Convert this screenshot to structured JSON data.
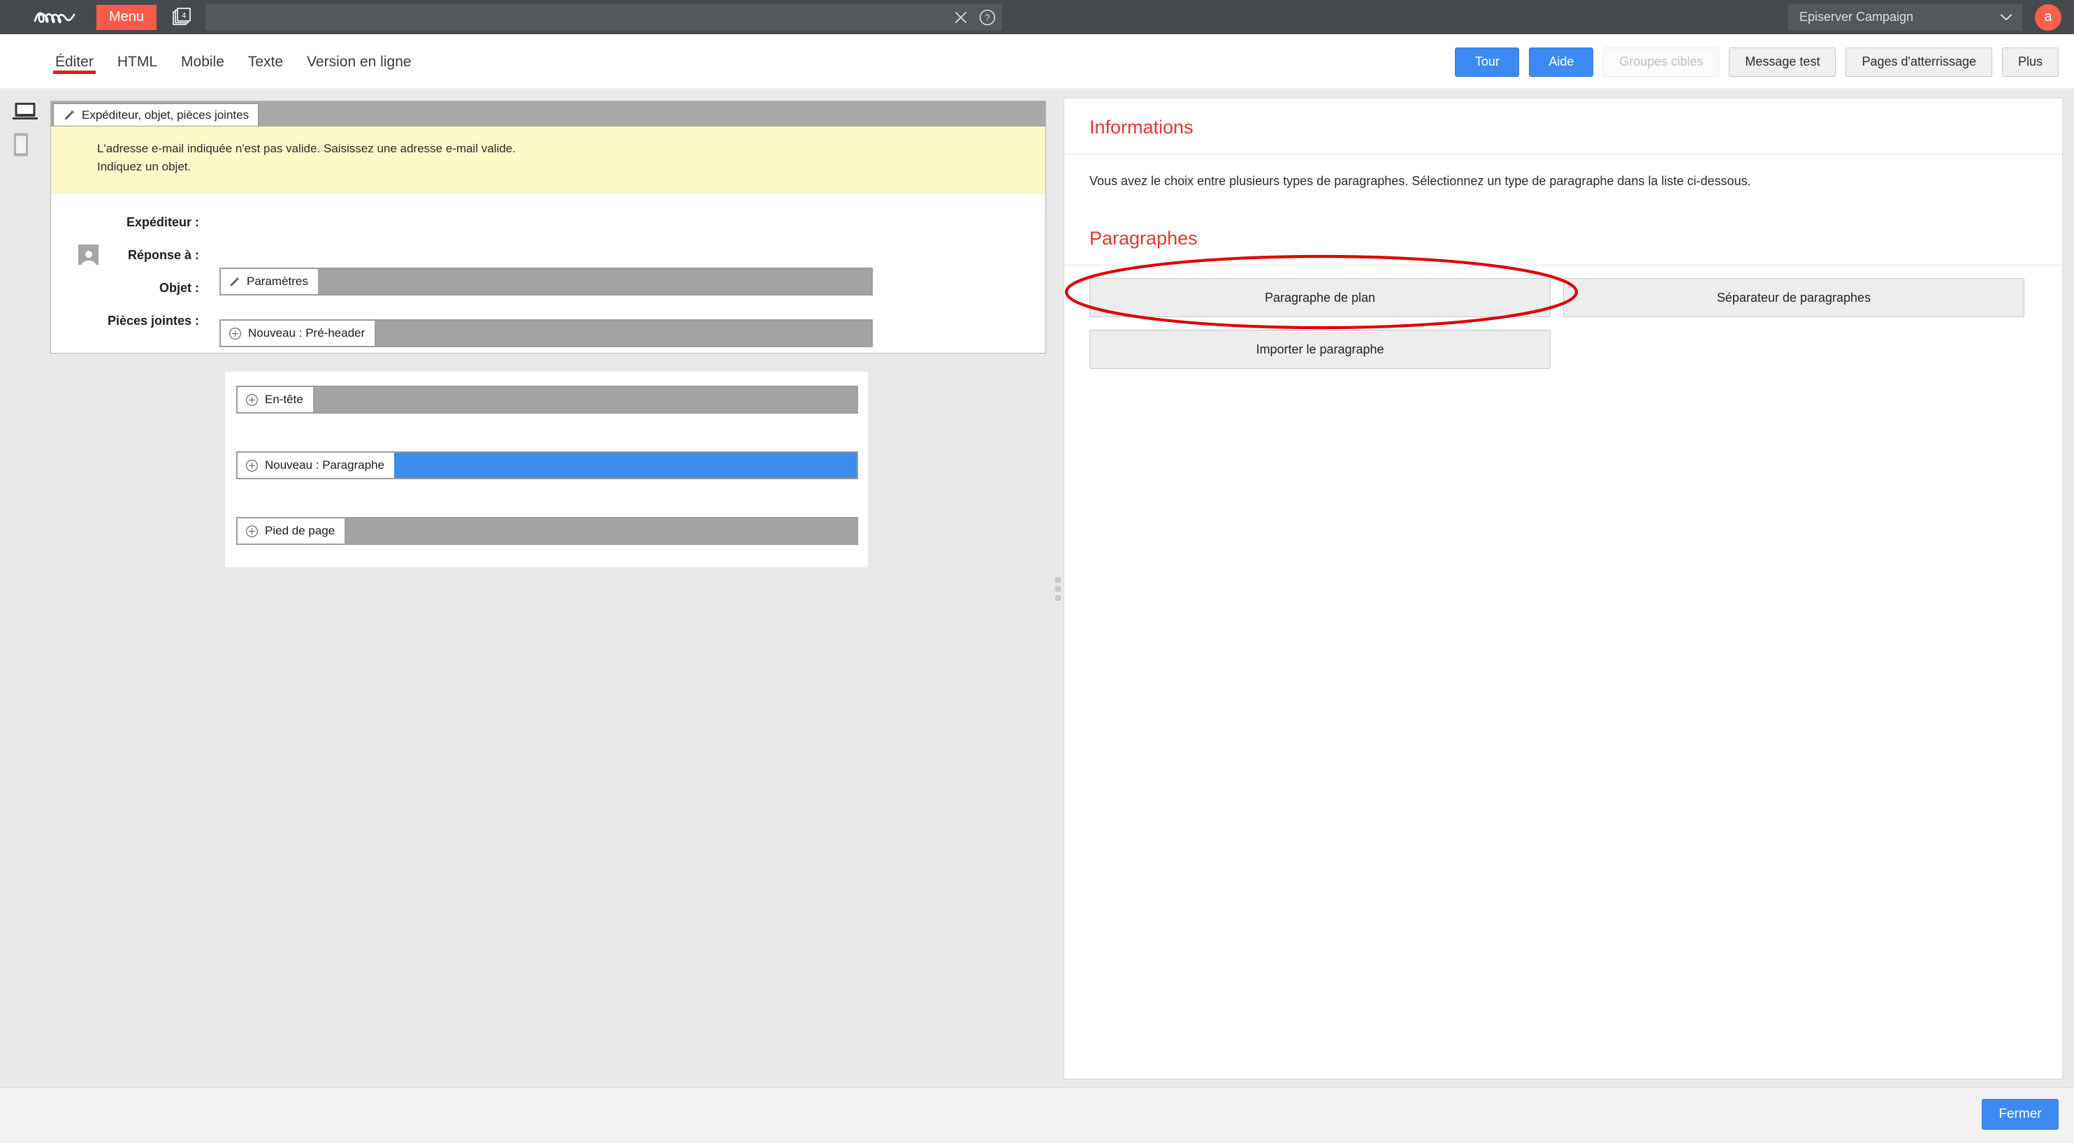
{
  "topbar": {
    "logo_alt": "Episerver",
    "menu_label": "Menu",
    "copies_badge": "4",
    "search_value": "",
    "search_placeholder": "",
    "app_selector_value": "Episerver Campaign",
    "avatar_initial": "a",
    "accent_orange": "#fc5a4b",
    "bar_bg": "#454a4d"
  },
  "toolbar": {
    "tabs": [
      {
        "label": "Éditer",
        "active": true
      },
      {
        "label": "HTML",
        "active": false
      },
      {
        "label": "Mobile",
        "active": false
      },
      {
        "label": "Texte",
        "active": false
      },
      {
        "label": "Version en ligne",
        "active": false
      }
    ],
    "buttons": [
      {
        "label": "Tour",
        "style": "primary"
      },
      {
        "label": "Aide",
        "style": "primary"
      },
      {
        "label": "Groupes cibles",
        "style": "disabled"
      },
      {
        "label": "Message test",
        "style": "normal"
      },
      {
        "label": "Pages d'atterrissage",
        "style": "normal"
      },
      {
        "label": "Plus",
        "style": "normal"
      }
    ],
    "active_tab_underline_color": "#e02020",
    "primary_color": "#3d8bf2"
  },
  "device_rail": {
    "desktop_label": "Aperçu bureau",
    "mobile_label": "Aperçu mobile"
  },
  "editor": {
    "sender_tab_label": "Expéditeur, objet, pièces jointes",
    "warning": {
      "line1": "L'adresse e-mail indiquée n'est pas valide. Saisissez une adresse e-mail valide.",
      "line2": "Indiquez un objet.",
      "bg": "#fcfac8"
    },
    "fields": [
      {
        "label": "Expéditeur :",
        "value": ""
      },
      {
        "label": "Réponse à :",
        "value": ""
      },
      {
        "label": "Objet :",
        "value": ""
      },
      {
        "label": "Pièces jointes :",
        "value": ""
      }
    ],
    "blocks": [
      {
        "id": "parametres",
        "label": "Paramètres",
        "icon": "brush-icon",
        "selected": false
      },
      {
        "id": "preheader",
        "label": "Nouveau : Pré-header",
        "icon": "plus-circle-icon",
        "selected": false
      },
      {
        "id": "entete",
        "label": "En-tête",
        "icon": "plus-circle-icon",
        "selected": false
      },
      {
        "id": "paragraphe",
        "label": "Nouveau : Paragraphe",
        "icon": "plus-circle-icon",
        "selected": true
      },
      {
        "id": "pied",
        "label": "Pied de page",
        "icon": "plus-circle-icon",
        "selected": false
      }
    ],
    "selected_fill_color": "#3d8ceb",
    "unselected_fill_color": "#a3a3a3"
  },
  "rightpanel": {
    "informations_title": "Informations",
    "informations_text": "Vous avez le choix entre plusieurs types de paragraphes. Sélectionnez un type de paragraphe dans la liste ci-dessous.",
    "paragraphes_title": "Paragraphes",
    "paragraph_buttons": [
      {
        "label": "Paragraphe de plan",
        "highlighted": true
      },
      {
        "label": "Séparateur de paragraphes",
        "highlighted": false
      },
      {
        "label": "Importer le paragraphe",
        "highlighted": false
      }
    ],
    "heading_color": "#e8342c",
    "annotation_color": "#e00000"
  },
  "bottombar": {
    "close_label": "Fermer"
  }
}
